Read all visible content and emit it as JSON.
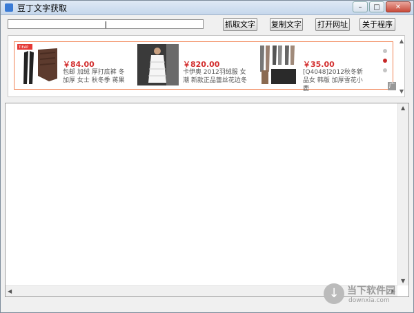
{
  "window": {
    "title": "豆丁文字获取",
    "controls": {
      "minimize": "–",
      "maximize": "□",
      "close": "✕"
    }
  },
  "toolbar": {
    "url_value": "",
    "buttons": [
      "抓取文字",
      "复制文字",
      "打开网址",
      "关于程序"
    ]
  },
  "ads": {
    "items": [
      {
        "price": "￥84.00",
        "description": "包邮 加绒 厚打底裤 冬加厚 女士 秋冬季 蒋果"
      },
      {
        "price": "￥820.00",
        "description": "卡伊奥 2012羽绒服 女 潮 新款正品蕾丝花边冬"
      },
      {
        "price": "￥35.00",
        "description": "[Q4048]2012秋冬新品女 韩版 加厚雪花小鹿"
      }
    ],
    "img_label": "TIEAP",
    "active_dot_index": 1,
    "badge": "广",
    "accent_color": "#f08050",
    "price_color": "#d32f2f"
  },
  "watermark": {
    "title": "当下软件园",
    "subtitle": "downxia.com"
  }
}
